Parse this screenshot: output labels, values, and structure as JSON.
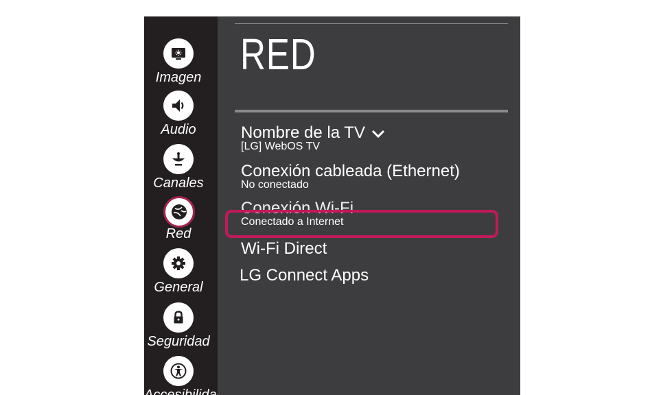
{
  "sidebar": {
    "items": [
      {
        "label": "Imagen",
        "icon": "picture-icon"
      },
      {
        "label": "Audio",
        "icon": "speaker-icon"
      },
      {
        "label": "Canales",
        "icon": "antenna-icon"
      },
      {
        "label": "Red",
        "icon": "globe-icon",
        "selected": true
      },
      {
        "label": "General",
        "icon": "gear-icon"
      },
      {
        "label": "Seguridad",
        "icon": "lock-icon"
      },
      {
        "label": "Accesibilidad",
        "icon": "accessibility-icon"
      }
    ]
  },
  "panel": {
    "title": "RED",
    "items": [
      {
        "label": "Nombre de la TV",
        "value": "[LG] WebOS TV",
        "icon": "chevron-down-icon"
      },
      {
        "label": "Conexión cableada (Ethernet)",
        "value": "No conectado"
      },
      {
        "label": "Conexión Wi-Fi",
        "value": "Conectado a Internet",
        "highlighted": true
      },
      {
        "label": "Wi-Fi Direct"
      },
      {
        "label": "LG Connect Apps"
      }
    ]
  },
  "colors": {
    "sidebar_bg": "#231f20",
    "panel_bg": "#3d3d3f",
    "highlight": "#c1195a",
    "selected_ring": "#a3224f"
  }
}
